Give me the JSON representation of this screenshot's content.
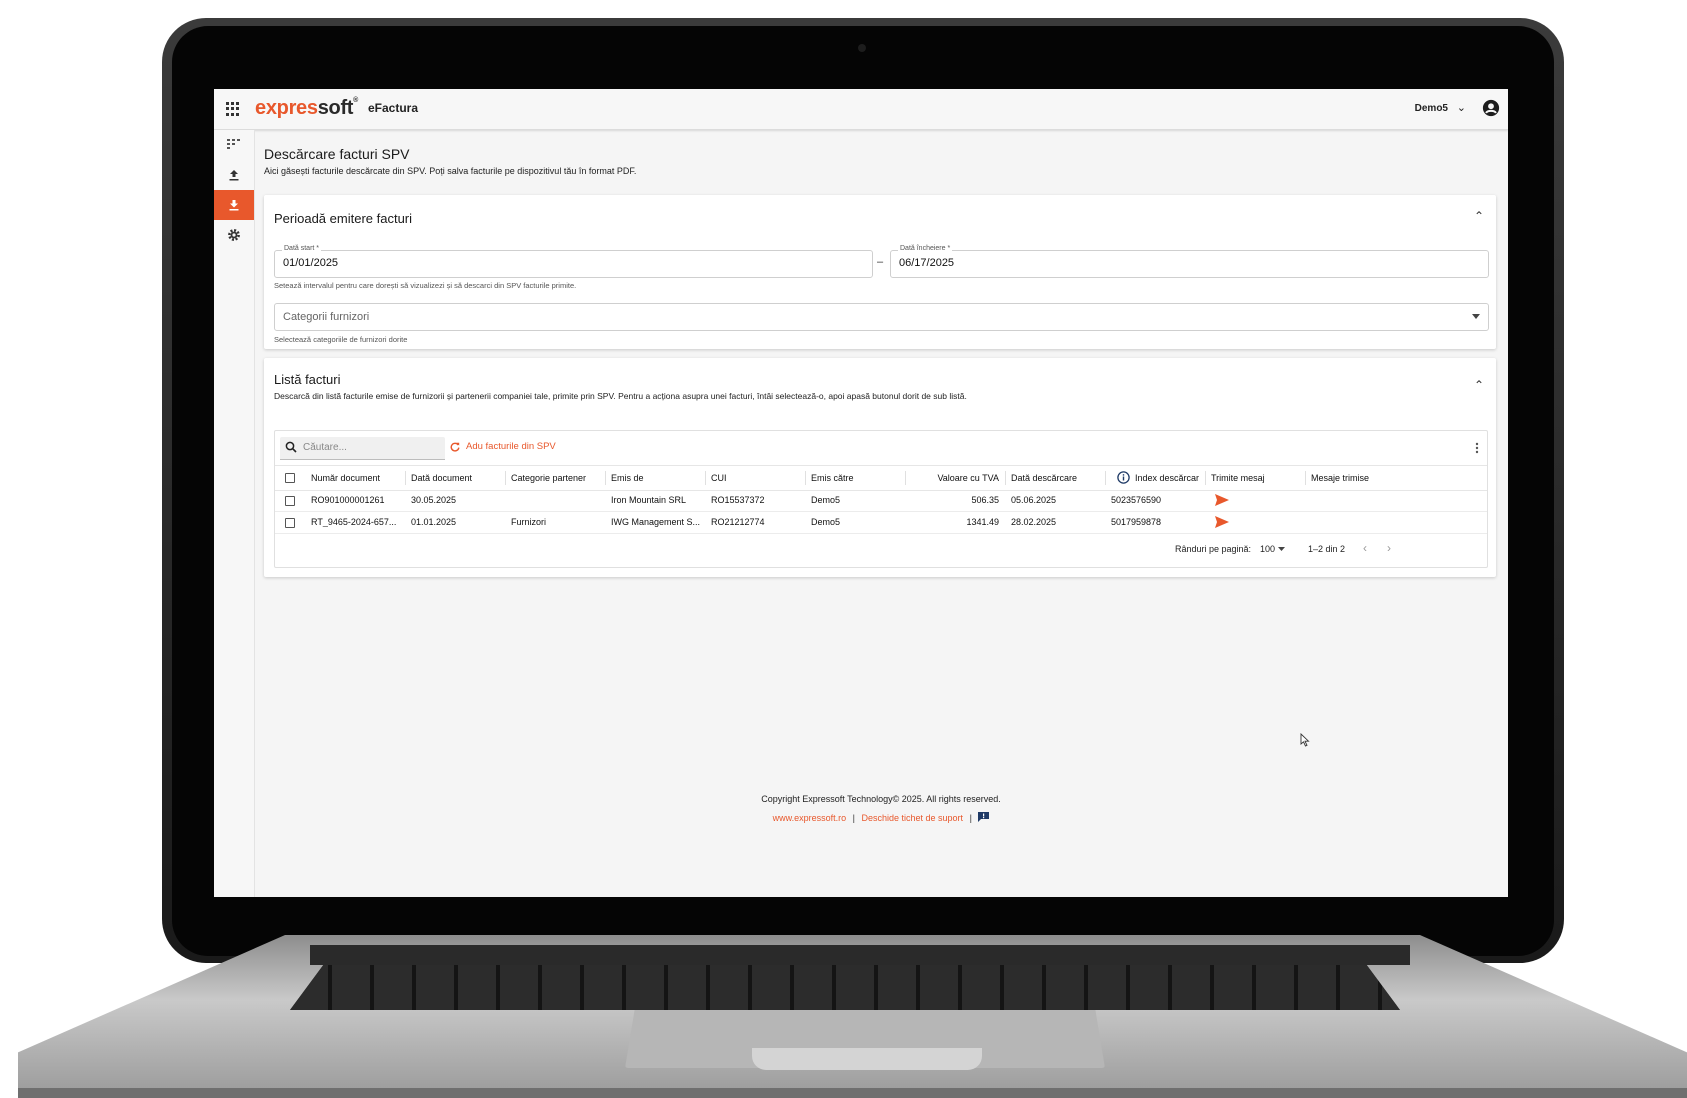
{
  "header": {
    "brand_part1": "expres",
    "brand_part2": "soft",
    "brand_mark": "®",
    "product": "eFactura",
    "user": "Demo5"
  },
  "colors": {
    "accent": "#e8582c",
    "text": "#1a1a1a",
    "background": "#f5f5f5"
  },
  "sidebar": {
    "items": [
      {
        "icon": "list-numbered-icon",
        "active": false
      },
      {
        "icon": "upload-icon",
        "active": false
      },
      {
        "icon": "download-icon",
        "active": true
      },
      {
        "icon": "gear-icon",
        "active": false
      }
    ]
  },
  "page": {
    "title": "Descărcare facturi SPV",
    "subtitle": "Aici găsești facturile descărcate din SPV. Poți salva facturile pe dispozitivul tău în format PDF."
  },
  "period": {
    "title": "Perioadă emitere facturi",
    "start_label": "Dată start *",
    "start_value": "01/01/2025",
    "separator": "–",
    "end_label": "Dată încheiere *",
    "end_value": "06/17/2025",
    "date_helper": "Setează intervalul pentru care dorești să vizualizezi și să descarci din SPV facturile primite.",
    "category_placeholder": "Categorii furnizori",
    "category_helper": "Selectează categoriile de furnizori dorite"
  },
  "invoices": {
    "title": "Listă facturi",
    "subtitle": "Descarcă din listă facturile emise de furnizorii și partenerii companiei tale, primite prin SPV. Pentru a acționa asupra unei facturi, întâi selectează-o, apoi apasă butonul dorit de sub listă.",
    "search_placeholder": "Căutare...",
    "fetch_label": "Adu facturile din SPV",
    "columns": [
      "Număr document",
      "Dată document",
      "Categorie partener",
      "Emis de",
      "CUI",
      "Emis către",
      "Valoare cu TVA",
      "Dată descărcare",
      "Index descărcar",
      "Trimite mesaj",
      "Mesaje trimise"
    ],
    "rows": [
      {
        "number": "RO901000001261",
        "date": "30.05.2025",
        "category": "",
        "issuer": "Iron Mountain SRL",
        "cui": "RO15537372",
        "recipient": "Demo5",
        "value": "506.35",
        "download_date": "05.06.2025",
        "index": "5023576590",
        "messages": ""
      },
      {
        "number": "RT_9465-2024-657...",
        "date": "01.01.2025",
        "category": "Furnizori",
        "issuer": "IWG Management S...",
        "cui": "RO21212774",
        "recipient": "Demo5",
        "value": "1341.49",
        "download_date": "28.02.2025",
        "index": "5017959878",
        "messages": ""
      }
    ],
    "rows_per_page_label": "Rânduri pe pagină:",
    "rows_per_page": "100",
    "page_range": "1–2 din 2"
  },
  "footer": {
    "copyright": "Copyright Expressoft Technology© 2025. All rights reserved.",
    "website": "www.expressoft.ro",
    "separator": "|",
    "support": "Deschide tichet de suport"
  }
}
